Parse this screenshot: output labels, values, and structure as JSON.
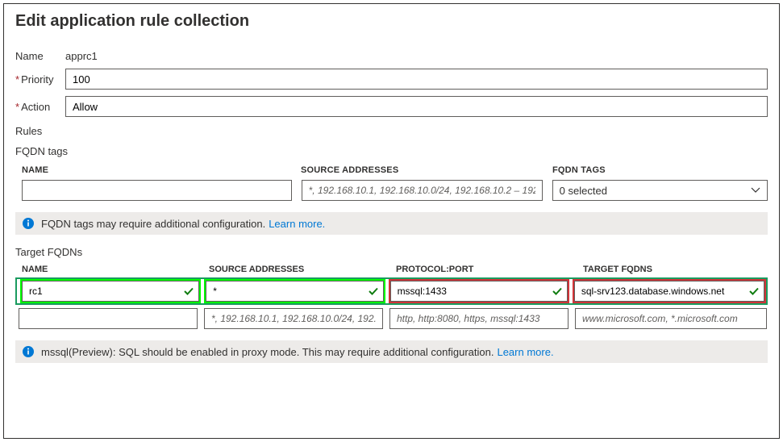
{
  "title": "Edit application rule collection",
  "form": {
    "name_label": "Name",
    "name_value": "apprc1",
    "priority_label": "Priority",
    "priority_value": "100",
    "action_label": "Action",
    "action_value": "Allow"
  },
  "rules_label": "Rules",
  "fqdn_tags": {
    "label": "FQDN tags",
    "headers": {
      "name": "NAME",
      "source": "SOURCE ADDRESSES",
      "tags": "FQDN TAGS"
    },
    "row": {
      "name_value": "",
      "source_placeholder": "*, 192.168.10.1, 192.168.10.0/24, 192.168.10.2 – 192.168...",
      "tags_selected": "0 selected"
    },
    "info": "FQDN tags may require additional configuration.",
    "learn_more": "Learn more."
  },
  "target_fqdns": {
    "label": "Target FQDNs",
    "headers": {
      "name": "NAME",
      "source": "SOURCE ADDRESSES",
      "protocol": "PROTOCOL:PORT",
      "target": "TARGET FQDNS"
    },
    "rows": [
      {
        "name": "rc1",
        "source": "*",
        "protocol": "mssql:1433",
        "target": "sql-srv123.database.windows.net"
      }
    ],
    "placeholder_row": {
      "name": "",
      "source_ph": "*, 192.168.10.1, 192.168.10.0/24, 192.16...",
      "protocol_ph": "http, http:8080, https, mssql:1433",
      "target_ph": "www.microsoft.com, *.microsoft.com"
    },
    "info": "mssql(Preview): SQL should be enabled in proxy mode. This may require additional configuration.",
    "learn_more": "Learn more."
  }
}
